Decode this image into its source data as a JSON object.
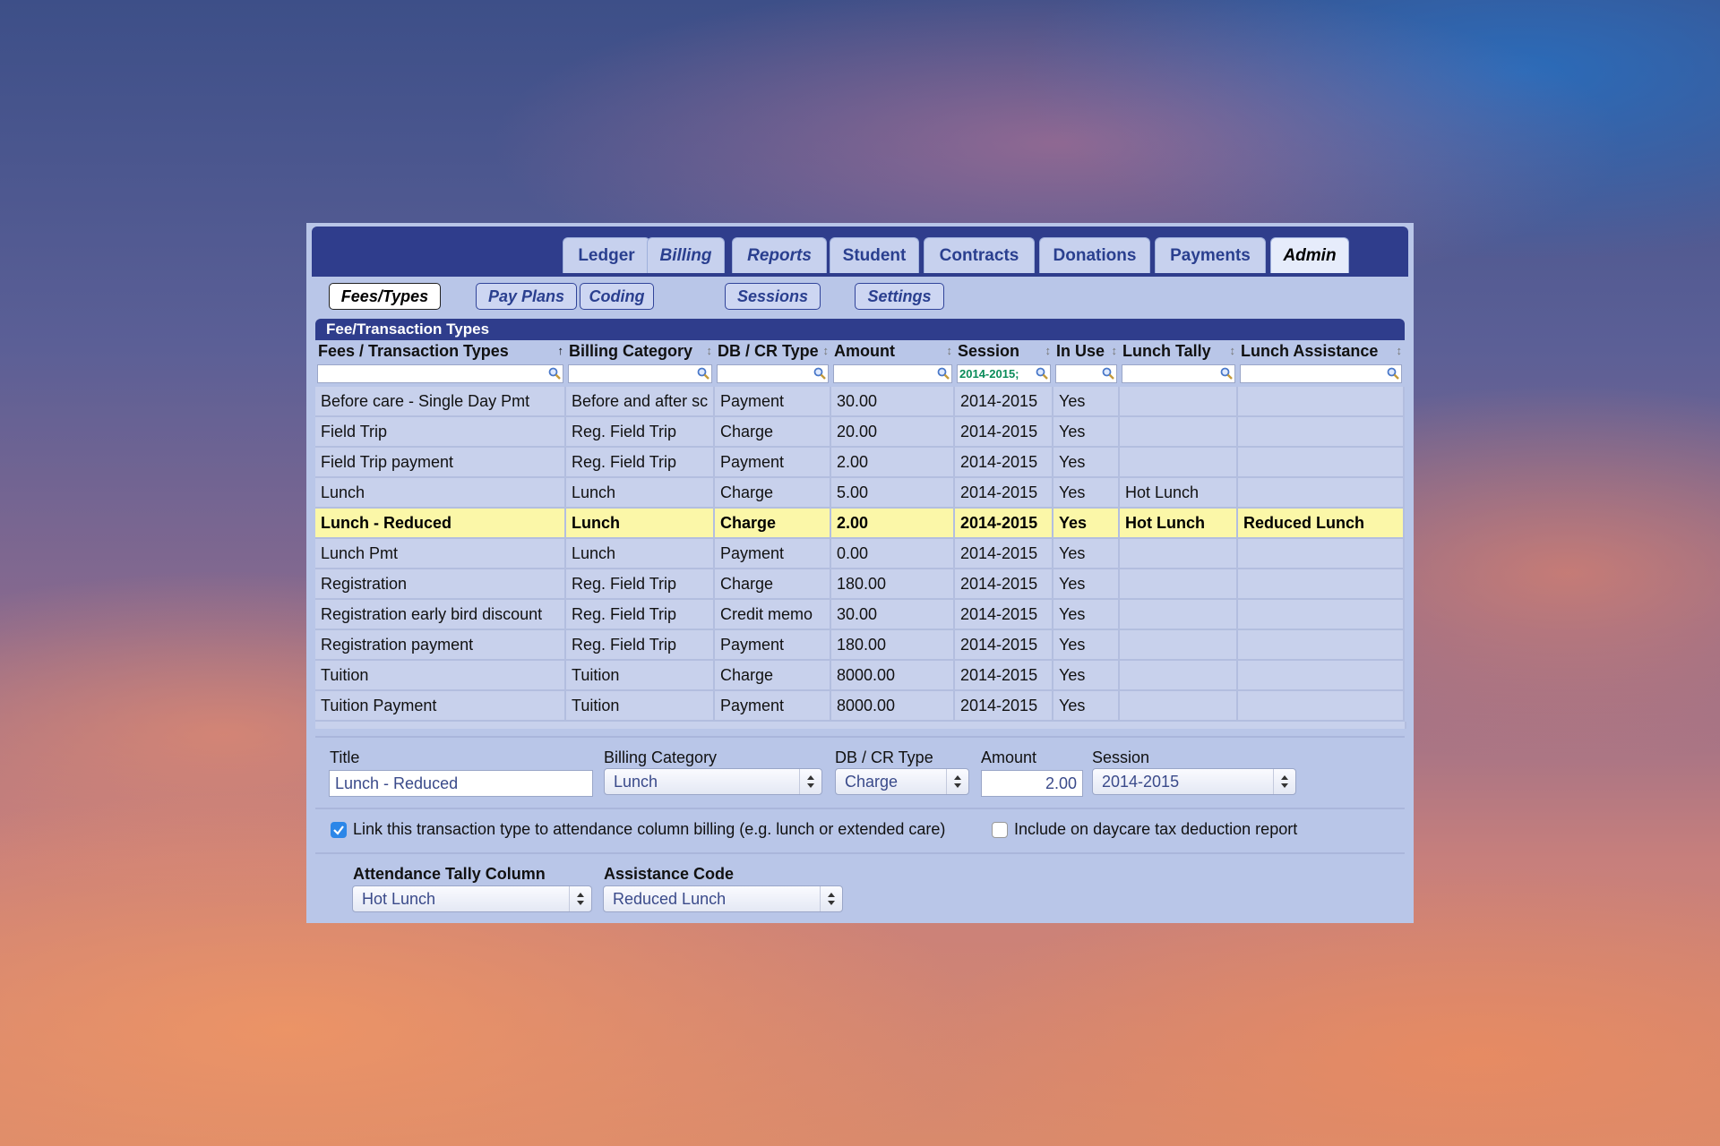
{
  "tabs": [
    {
      "label": "Ledger",
      "italic": false,
      "active": false
    },
    {
      "label": "Billing",
      "italic": true,
      "active": false
    },
    {
      "label": "Reports",
      "italic": true,
      "active": false
    },
    {
      "label": "Student",
      "italic": false,
      "active": false
    },
    {
      "label": "Contracts",
      "italic": false,
      "active": false
    },
    {
      "label": "Donations",
      "italic": false,
      "active": false
    },
    {
      "label": "Payments",
      "italic": false,
      "active": false
    },
    {
      "label": "Admin",
      "italic": true,
      "active": true
    }
  ],
  "subtabs": [
    {
      "label": "Fees/Types",
      "active": true
    },
    {
      "label": "Pay Plans",
      "active": false
    },
    {
      "label": "Coding",
      "active": false
    },
    {
      "label": "Sessions",
      "active": false
    },
    {
      "label": "Settings",
      "active": false
    }
  ],
  "panel_title": "Fee/Transaction Types",
  "table": {
    "columns": [
      {
        "label": "Fees / Transaction Types",
        "sort": "asc",
        "filter": ""
      },
      {
        "label": "Billing Category",
        "sort": "both",
        "filter": ""
      },
      {
        "label": "DB / CR Type",
        "sort": "both",
        "filter": ""
      },
      {
        "label": "Amount",
        "sort": "both",
        "filter": ""
      },
      {
        "label": "Session",
        "sort": "both",
        "filter": "2014-2015;"
      },
      {
        "label": "In Use",
        "sort": "both",
        "filter": ""
      },
      {
        "label": "Lunch Tally",
        "sort": "both",
        "filter": ""
      },
      {
        "label": "Lunch Assistance",
        "sort": "both",
        "filter": ""
      }
    ],
    "rows": [
      [
        "Before care - Single Day Pmt",
        "Before and after sc",
        "Payment",
        "30.00",
        "2014-2015",
        "Yes",
        "",
        ""
      ],
      [
        "Field Trip",
        "Reg. Field Trip",
        "Charge",
        "20.00",
        "2014-2015",
        "Yes",
        "",
        ""
      ],
      [
        "Field Trip payment",
        "Reg. Field Trip",
        "Payment",
        "2.00",
        "2014-2015",
        "Yes",
        "",
        ""
      ],
      [
        "Lunch",
        "Lunch",
        "Charge",
        "5.00",
        "2014-2015",
        "Yes",
        "Hot Lunch",
        ""
      ],
      [
        "Lunch - Reduced",
        "Lunch",
        "Charge",
        "2.00",
        "2014-2015",
        "Yes",
        "Hot Lunch",
        "Reduced Lunch"
      ],
      [
        "Lunch Pmt",
        "Lunch",
        "Payment",
        "0.00",
        "2014-2015",
        "Yes",
        "",
        ""
      ],
      [
        "Registration",
        "Reg. Field Trip",
        "Charge",
        "180.00",
        "2014-2015",
        "Yes",
        "",
        ""
      ],
      [
        "Registration early bird discount",
        "Reg. Field Trip",
        "Credit memo",
        "30.00",
        "2014-2015",
        "Yes",
        "",
        ""
      ],
      [
        "Registration payment",
        "Reg. Field Trip",
        "Payment",
        "180.00",
        "2014-2015",
        "Yes",
        "",
        ""
      ],
      [
        "Tuition",
        "Tuition",
        "Charge",
        "8000.00",
        "2014-2015",
        "Yes",
        "",
        ""
      ],
      [
        "Tuition Payment",
        "Tuition",
        "Payment",
        "8000.00",
        "2014-2015",
        "Yes",
        "",
        ""
      ]
    ],
    "selected_row": 4
  },
  "form": {
    "title_label": "Title",
    "title_value": "Lunch - Reduced",
    "billing_label": "Billing Category",
    "billing_value": "Lunch",
    "dbcr_label": "DB / CR Type",
    "dbcr_value": "Charge",
    "amount_label": "Amount",
    "amount_value": "2.00",
    "session_label": "Session",
    "session_value": "2014-2015",
    "link_label": "Link this transaction type to attendance column billing (e.g. lunch or extended care)",
    "link_checked": true,
    "daycare_label": "Include on daycare tax deduction report",
    "daycare_checked": false,
    "tally_label": "Attendance Tally Column",
    "tally_value": "Hot Lunch",
    "assist_label": "Assistance Code",
    "assist_value": "Reduced Lunch"
  },
  "colors": {
    "nav_dark": "#2f3d8c",
    "panel_bg": "#b9c6e8",
    "row_bg": "#c8d1ec",
    "selected_row": "#fbf7a8",
    "checkbox_on": "#2b86e8"
  }
}
